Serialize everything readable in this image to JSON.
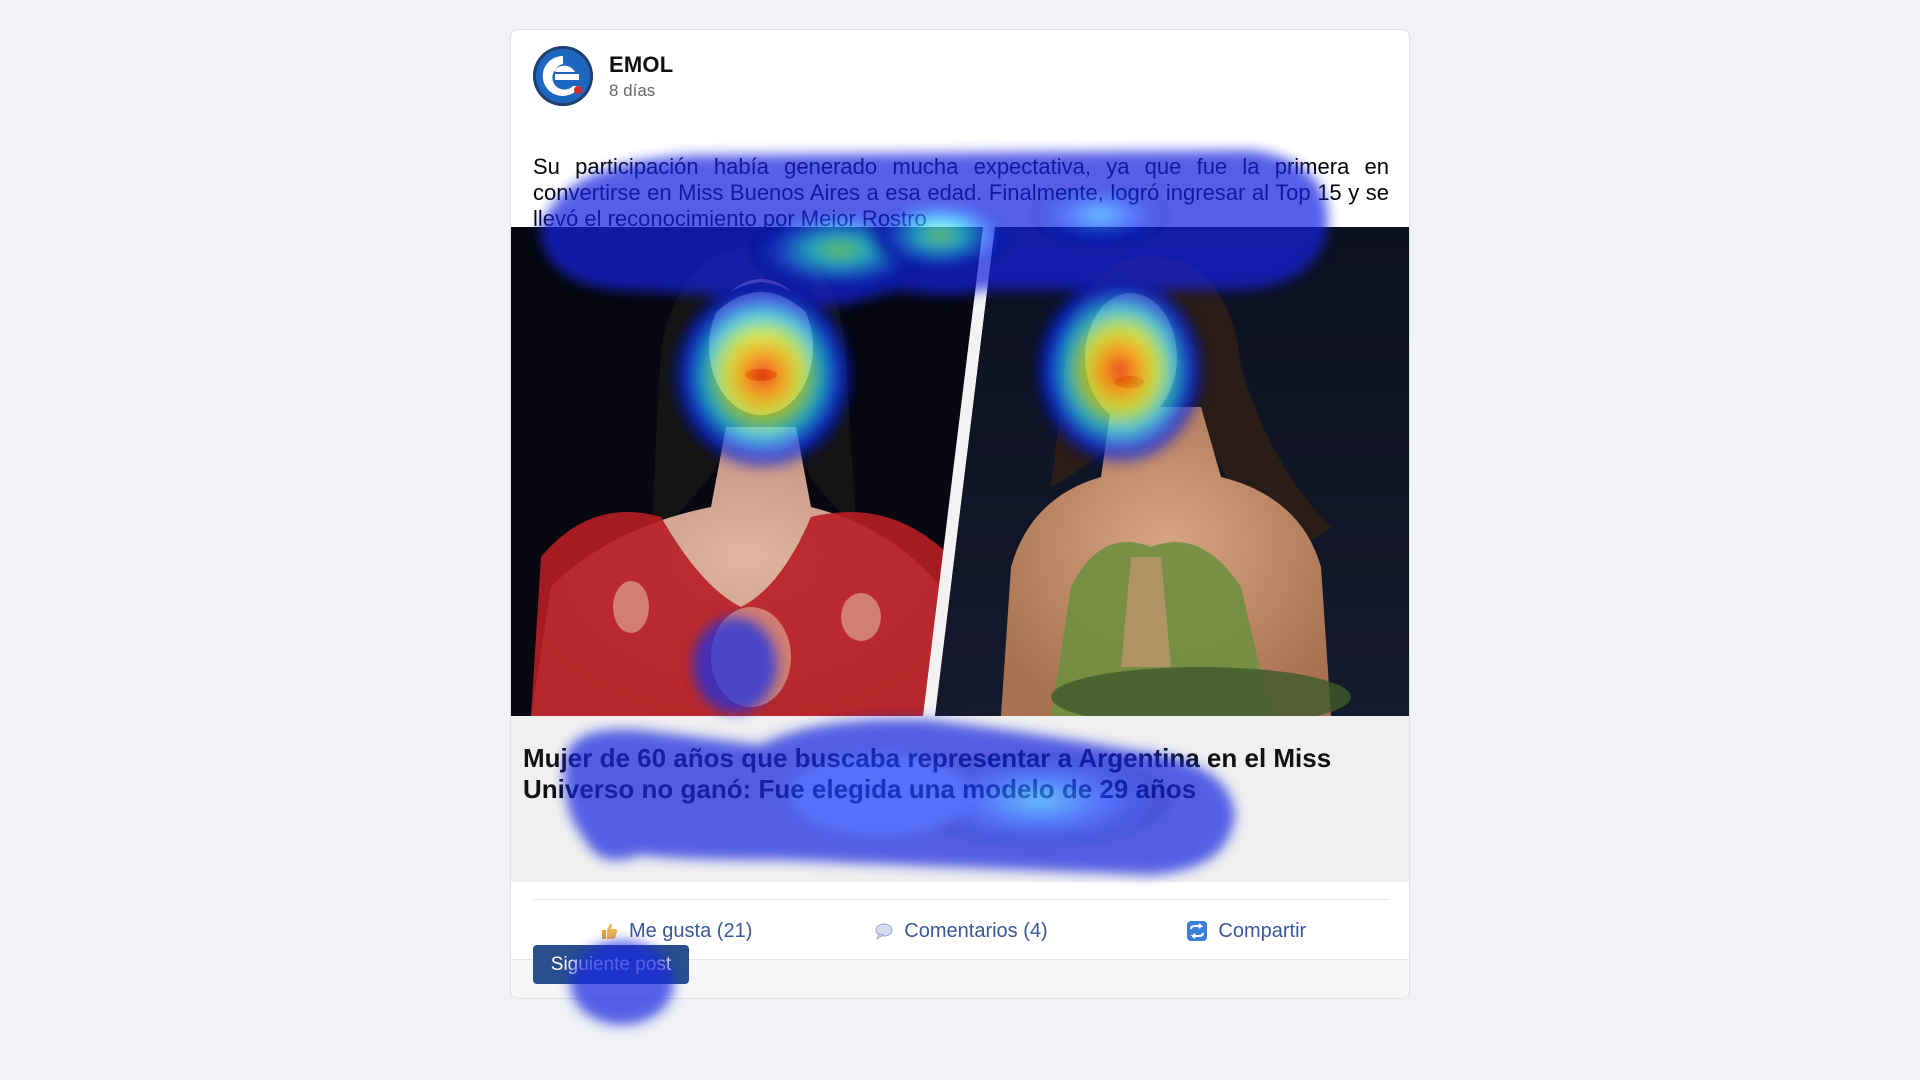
{
  "post": {
    "author": "EMOL",
    "time": "8 días",
    "text": "Su participación había generado mucha expectativa, ya que fue la primera en convertirse en Miss Buenos Aires a esa edad. Finalmente, logró ingresar al Top 15 y se llevó el reconocimiento por Mejor Rostro"
  },
  "link_preview": {
    "title": "Mujer de 60 años que buscaba representar a Argentina en el Miss Universo no ganó: Fue elegida una modelo de 29 años"
  },
  "actions": {
    "like": "Me gusta (21)",
    "comment": "Comentarios (4)",
    "share": "Compartir"
  },
  "next_button": "Siguiente post",
  "icons": {
    "avatar": "emol-logo-icon",
    "like": "thumbs-up-icon",
    "comment": "speech-bubble-icon",
    "share": "share-arrows-icon"
  },
  "colors": {
    "link_blue": "#385898",
    "button_bg": "#2b4f8c",
    "page_bg": "#f0f2f5",
    "preview_bg": "#f0f0f0"
  }
}
